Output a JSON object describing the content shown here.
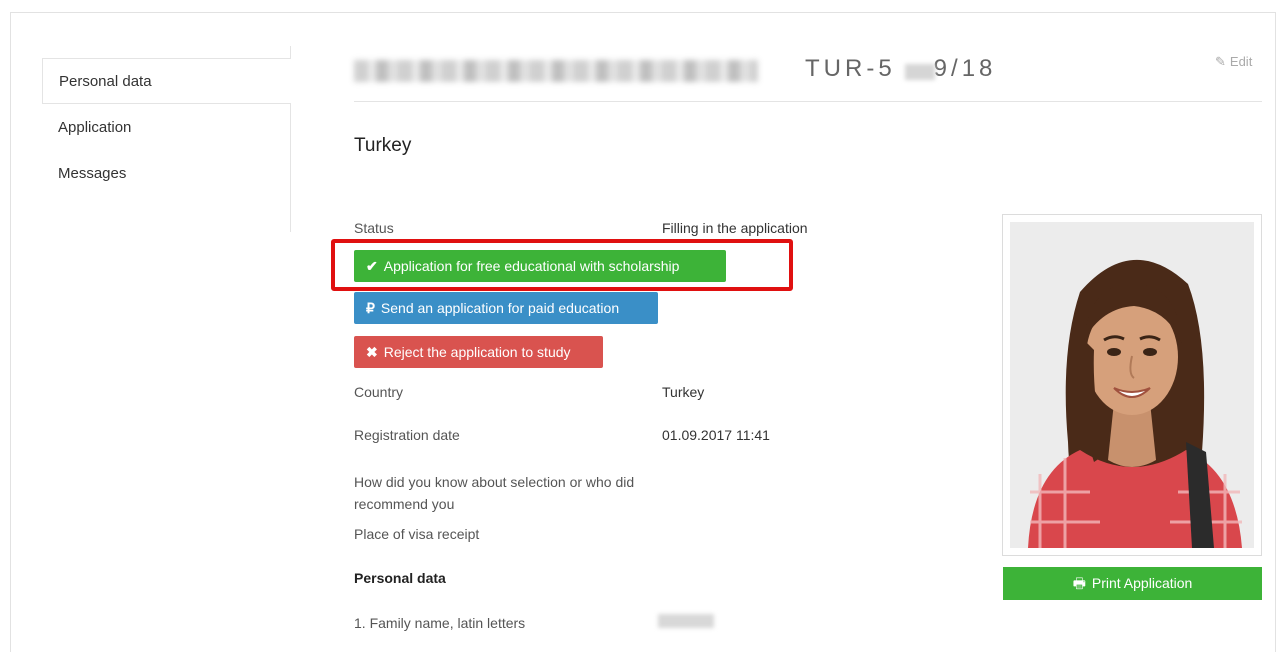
{
  "sidebar": {
    "items": [
      {
        "label": "Personal data",
        "active": true
      },
      {
        "label": "Application",
        "active": false
      },
      {
        "label": "Messages",
        "active": false
      }
    ]
  },
  "header": {
    "reference_prefix": "TUR-5",
    "reference_suffix": "9/18",
    "edit_label": "Edit"
  },
  "main": {
    "country_title": "Turkey",
    "status": {
      "label": "Status",
      "value": "Filling in the application"
    },
    "actions": {
      "free_education": "Application for free educational with scholarship",
      "paid_education": "Send an application for paid education",
      "reject": "Reject the application to study"
    },
    "fields": {
      "country_label": "Country",
      "country_value": "Turkey",
      "registration_label": "Registration date",
      "registration_value": "01.09.2017 11:41",
      "referral_label": "How did you know about selection or who did recommend you",
      "visa_label": "Place of visa receipt"
    },
    "personal_section_title": "Personal data",
    "family_name_label": "1. Family name, latin letters"
  },
  "photo": {
    "print_label": "Print Application"
  },
  "colors": {
    "green": "#3db338",
    "blue": "#3a8fc7",
    "red": "#d9534f",
    "highlight": "#e01010"
  },
  "icons": {
    "check": "check-icon",
    "ruble": "ruble-icon",
    "cross": "close-icon",
    "pencil": "pencil-icon",
    "print": "print-icon"
  }
}
